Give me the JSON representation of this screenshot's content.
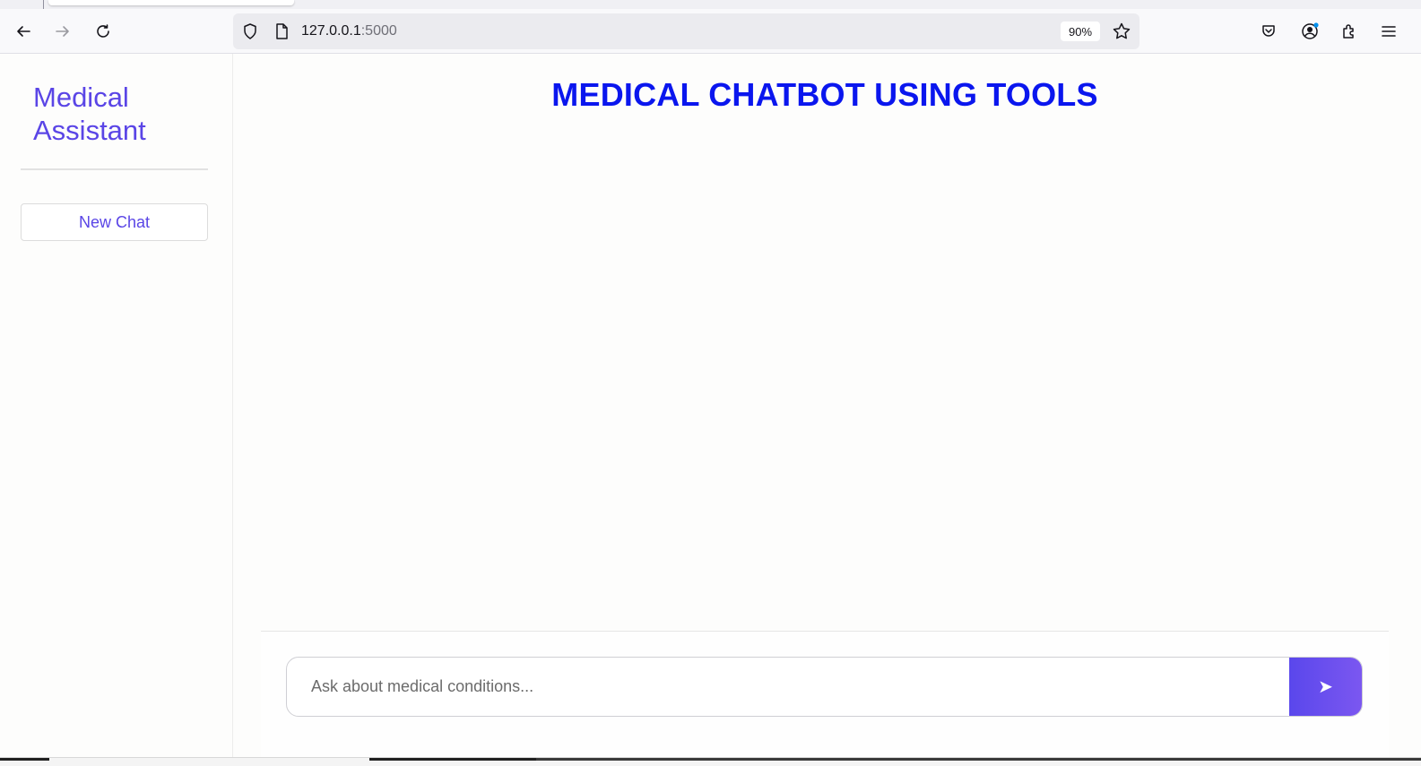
{
  "browser": {
    "url_host": "127.0.0.1",
    "url_port": ":5000",
    "zoom": "90%"
  },
  "sidebar": {
    "brand_line1": "Medical",
    "brand_line2": "Assistant",
    "new_chat_label": "New Chat"
  },
  "main": {
    "title": "MEDICAL CHATBOT USING TOOLS",
    "input_placeholder": "Ask about medical conditions...",
    "input_value": "",
    "send_label": "➤"
  },
  "colors": {
    "accent": "#5a45e6",
    "title": "#0a16ee"
  },
  "icons": [
    "back-arrow-icon",
    "forward-arrow-icon",
    "reload-icon",
    "shield-icon",
    "page-icon",
    "star-icon",
    "pocket-icon",
    "account-icon",
    "extensions-icon",
    "menu-icon",
    "send-icon"
  ]
}
